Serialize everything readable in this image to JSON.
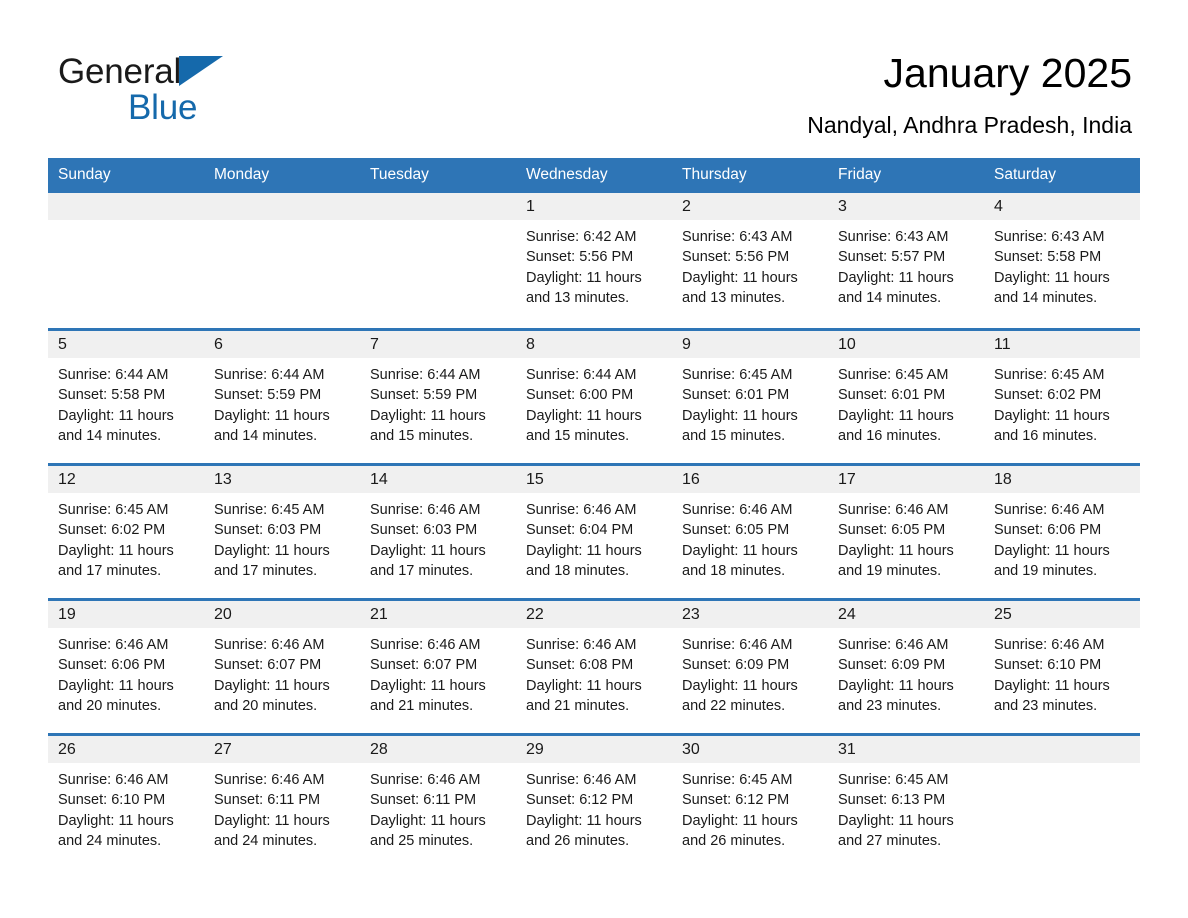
{
  "brand": {
    "name_part1": "General",
    "name_part2": "Blue",
    "accent_color": "#1569ab",
    "triangle_icon": "brand-triangle-icon"
  },
  "header": {
    "month_title": "January 2025",
    "location": "Nandyal, Andhra Pradesh, India"
  },
  "calendar": {
    "header_bg": "#2e75b6",
    "daynum_bg": "#f0f0f0",
    "weekday_headers": [
      "Sunday",
      "Monday",
      "Tuesday",
      "Wednesday",
      "Thursday",
      "Friday",
      "Saturday"
    ],
    "weeks": [
      [
        {
          "day": "",
          "sunrise": "",
          "sunset": "",
          "daylight_line1": "",
          "daylight_line2": ""
        },
        {
          "day": "",
          "sunrise": "",
          "sunset": "",
          "daylight_line1": "",
          "daylight_line2": ""
        },
        {
          "day": "",
          "sunrise": "",
          "sunset": "",
          "daylight_line1": "",
          "daylight_line2": ""
        },
        {
          "day": "1",
          "sunrise": "Sunrise: 6:42 AM",
          "sunset": "Sunset: 5:56 PM",
          "daylight_line1": "Daylight: 11 hours",
          "daylight_line2": "and 13 minutes."
        },
        {
          "day": "2",
          "sunrise": "Sunrise: 6:43 AM",
          "sunset": "Sunset: 5:56 PM",
          "daylight_line1": "Daylight: 11 hours",
          "daylight_line2": "and 13 minutes."
        },
        {
          "day": "3",
          "sunrise": "Sunrise: 6:43 AM",
          "sunset": "Sunset: 5:57 PM",
          "daylight_line1": "Daylight: 11 hours",
          "daylight_line2": "and 14 minutes."
        },
        {
          "day": "4",
          "sunrise": "Sunrise: 6:43 AM",
          "sunset": "Sunset: 5:58 PM",
          "daylight_line1": "Daylight: 11 hours",
          "daylight_line2": "and 14 minutes."
        }
      ],
      [
        {
          "day": "5",
          "sunrise": "Sunrise: 6:44 AM",
          "sunset": "Sunset: 5:58 PM",
          "daylight_line1": "Daylight: 11 hours",
          "daylight_line2": "and 14 minutes."
        },
        {
          "day": "6",
          "sunrise": "Sunrise: 6:44 AM",
          "sunset": "Sunset: 5:59 PM",
          "daylight_line1": "Daylight: 11 hours",
          "daylight_line2": "and 14 minutes."
        },
        {
          "day": "7",
          "sunrise": "Sunrise: 6:44 AM",
          "sunset": "Sunset: 5:59 PM",
          "daylight_line1": "Daylight: 11 hours",
          "daylight_line2": "and 15 minutes."
        },
        {
          "day": "8",
          "sunrise": "Sunrise: 6:44 AM",
          "sunset": "Sunset: 6:00 PM",
          "daylight_line1": "Daylight: 11 hours",
          "daylight_line2": "and 15 minutes."
        },
        {
          "day": "9",
          "sunrise": "Sunrise: 6:45 AM",
          "sunset": "Sunset: 6:01 PM",
          "daylight_line1": "Daylight: 11 hours",
          "daylight_line2": "and 15 minutes."
        },
        {
          "day": "10",
          "sunrise": "Sunrise: 6:45 AM",
          "sunset": "Sunset: 6:01 PM",
          "daylight_line1": "Daylight: 11 hours",
          "daylight_line2": "and 16 minutes."
        },
        {
          "day": "11",
          "sunrise": "Sunrise: 6:45 AM",
          "sunset": "Sunset: 6:02 PM",
          "daylight_line1": "Daylight: 11 hours",
          "daylight_line2": "and 16 minutes."
        }
      ],
      [
        {
          "day": "12",
          "sunrise": "Sunrise: 6:45 AM",
          "sunset": "Sunset: 6:02 PM",
          "daylight_line1": "Daylight: 11 hours",
          "daylight_line2": "and 17 minutes."
        },
        {
          "day": "13",
          "sunrise": "Sunrise: 6:45 AM",
          "sunset": "Sunset: 6:03 PM",
          "daylight_line1": "Daylight: 11 hours",
          "daylight_line2": "and 17 minutes."
        },
        {
          "day": "14",
          "sunrise": "Sunrise: 6:46 AM",
          "sunset": "Sunset: 6:03 PM",
          "daylight_line1": "Daylight: 11 hours",
          "daylight_line2": "and 17 minutes."
        },
        {
          "day": "15",
          "sunrise": "Sunrise: 6:46 AM",
          "sunset": "Sunset: 6:04 PM",
          "daylight_line1": "Daylight: 11 hours",
          "daylight_line2": "and 18 minutes."
        },
        {
          "day": "16",
          "sunrise": "Sunrise: 6:46 AM",
          "sunset": "Sunset: 6:05 PM",
          "daylight_line1": "Daylight: 11 hours",
          "daylight_line2": "and 18 minutes."
        },
        {
          "day": "17",
          "sunrise": "Sunrise: 6:46 AM",
          "sunset": "Sunset: 6:05 PM",
          "daylight_line1": "Daylight: 11 hours",
          "daylight_line2": "and 19 minutes."
        },
        {
          "day": "18",
          "sunrise": "Sunrise: 6:46 AM",
          "sunset": "Sunset: 6:06 PM",
          "daylight_line1": "Daylight: 11 hours",
          "daylight_line2": "and 19 minutes."
        }
      ],
      [
        {
          "day": "19",
          "sunrise": "Sunrise: 6:46 AM",
          "sunset": "Sunset: 6:06 PM",
          "daylight_line1": "Daylight: 11 hours",
          "daylight_line2": "and 20 minutes."
        },
        {
          "day": "20",
          "sunrise": "Sunrise: 6:46 AM",
          "sunset": "Sunset: 6:07 PM",
          "daylight_line1": "Daylight: 11 hours",
          "daylight_line2": "and 20 minutes."
        },
        {
          "day": "21",
          "sunrise": "Sunrise: 6:46 AM",
          "sunset": "Sunset: 6:07 PM",
          "daylight_line1": "Daylight: 11 hours",
          "daylight_line2": "and 21 minutes."
        },
        {
          "day": "22",
          "sunrise": "Sunrise: 6:46 AM",
          "sunset": "Sunset: 6:08 PM",
          "daylight_line1": "Daylight: 11 hours",
          "daylight_line2": "and 21 minutes."
        },
        {
          "day": "23",
          "sunrise": "Sunrise: 6:46 AM",
          "sunset": "Sunset: 6:09 PM",
          "daylight_line1": "Daylight: 11 hours",
          "daylight_line2": "and 22 minutes."
        },
        {
          "day": "24",
          "sunrise": "Sunrise: 6:46 AM",
          "sunset": "Sunset: 6:09 PM",
          "daylight_line1": "Daylight: 11 hours",
          "daylight_line2": "and 23 minutes."
        },
        {
          "day": "25",
          "sunrise": "Sunrise: 6:46 AM",
          "sunset": "Sunset: 6:10 PM",
          "daylight_line1": "Daylight: 11 hours",
          "daylight_line2": "and 23 minutes."
        }
      ],
      [
        {
          "day": "26",
          "sunrise": "Sunrise: 6:46 AM",
          "sunset": "Sunset: 6:10 PM",
          "daylight_line1": "Daylight: 11 hours",
          "daylight_line2": "and 24 minutes."
        },
        {
          "day": "27",
          "sunrise": "Sunrise: 6:46 AM",
          "sunset": "Sunset: 6:11 PM",
          "daylight_line1": "Daylight: 11 hours",
          "daylight_line2": "and 24 minutes."
        },
        {
          "day": "28",
          "sunrise": "Sunrise: 6:46 AM",
          "sunset": "Sunset: 6:11 PM",
          "daylight_line1": "Daylight: 11 hours",
          "daylight_line2": "and 25 minutes."
        },
        {
          "day": "29",
          "sunrise": "Sunrise: 6:46 AM",
          "sunset": "Sunset: 6:12 PM",
          "daylight_line1": "Daylight: 11 hours",
          "daylight_line2": "and 26 minutes."
        },
        {
          "day": "30",
          "sunrise": "Sunrise: 6:45 AM",
          "sunset": "Sunset: 6:12 PM",
          "daylight_line1": "Daylight: 11 hours",
          "daylight_line2": "and 26 minutes."
        },
        {
          "day": "31",
          "sunrise": "Sunrise: 6:45 AM",
          "sunset": "Sunset: 6:13 PM",
          "daylight_line1": "Daylight: 11 hours",
          "daylight_line2": "and 27 minutes."
        },
        {
          "day": "",
          "sunrise": "",
          "sunset": "",
          "daylight_line1": "",
          "daylight_line2": ""
        }
      ]
    ]
  }
}
